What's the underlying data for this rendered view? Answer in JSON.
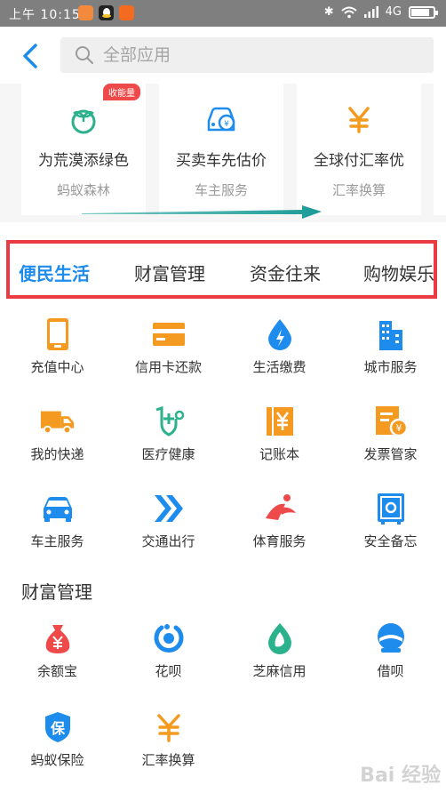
{
  "status_bar": {
    "time": "上午 10:15",
    "network": "4G"
  },
  "header": {
    "search_placeholder": "全部应用"
  },
  "recommend": [
    {
      "title": "为荒漠添绿色",
      "sub": "蚂蚁森林",
      "badge": "收能量",
      "icon": "sprout-icon"
    },
    {
      "title": "买卖车先估价",
      "sub": "车主服务",
      "icon": "car-price-icon"
    },
    {
      "title": "全球付汇率优",
      "sub": "汇率换算",
      "icon": "yen-icon"
    }
  ],
  "tabs": [
    "便民生活",
    "财富管理",
    "资金往来",
    "购物娱乐"
  ],
  "life_items": [
    {
      "label": "充值中心",
      "icon": "phone-icon"
    },
    {
      "label": "信用卡还款",
      "icon": "credit-card-icon"
    },
    {
      "label": "生活缴费",
      "icon": "utility-drop-icon"
    },
    {
      "label": "城市服务",
      "icon": "city-buildings-icon"
    },
    {
      "label": "我的快递",
      "icon": "delivery-truck-icon"
    },
    {
      "label": "医疗健康",
      "icon": "medical-shield-icon"
    },
    {
      "label": "记账本",
      "icon": "ledger-icon"
    },
    {
      "label": "发票管家",
      "icon": "invoice-icon"
    },
    {
      "label": "车主服务",
      "icon": "car-icon"
    },
    {
      "label": "交通出行",
      "icon": "double-chevron-icon"
    },
    {
      "label": "体育服务",
      "icon": "sports-runner-icon"
    },
    {
      "label": "安全备忘",
      "icon": "safe-box-icon"
    }
  ],
  "wealth": {
    "title": "财富管理",
    "items": [
      {
        "label": "余额宝",
        "icon": "money-bag-icon"
      },
      {
        "label": "花呗",
        "icon": "huabei-icon"
      },
      {
        "label": "芝麻信用",
        "icon": "sesame-credit-icon"
      },
      {
        "label": "借呗",
        "icon": "jiebei-icon"
      },
      {
        "label": "蚂蚁保险",
        "icon": "insurance-shield-icon"
      },
      {
        "label": "汇率换算",
        "icon": "exchange-yen-icon"
      }
    ]
  },
  "watermark": "Bai 经验"
}
